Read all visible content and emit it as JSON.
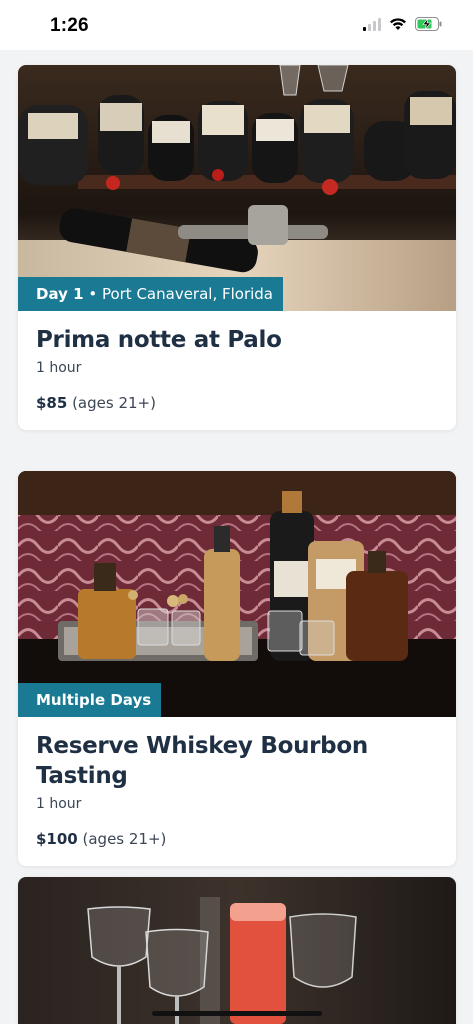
{
  "status_bar": {
    "time": "1:26"
  },
  "cards": [
    {
      "badge_strong": "Day 1",
      "badge_rest": " • Port Canaveral, Florida",
      "title": "Prima notte at Palo",
      "duration": "1 hour",
      "price": "$85",
      "price_note": " (ages 21+)",
      "image": "wine-bottles-cellar-photo"
    },
    {
      "badge_strong": "Multiple Days",
      "badge_rest": "",
      "title": "Reserve Whiskey Bourbon Tasting",
      "duration": "1 hour",
      "price": "$100",
      "price_note": " (ages 21+)",
      "image": "whiskey-bottles-bar-cart-photo"
    },
    {
      "image": "cocktail-glasses-photo"
    }
  ],
  "colors": {
    "badge_bg": "#1b7a93",
    "title": "#1f2f44",
    "page_bg": "#f2f3f5"
  }
}
